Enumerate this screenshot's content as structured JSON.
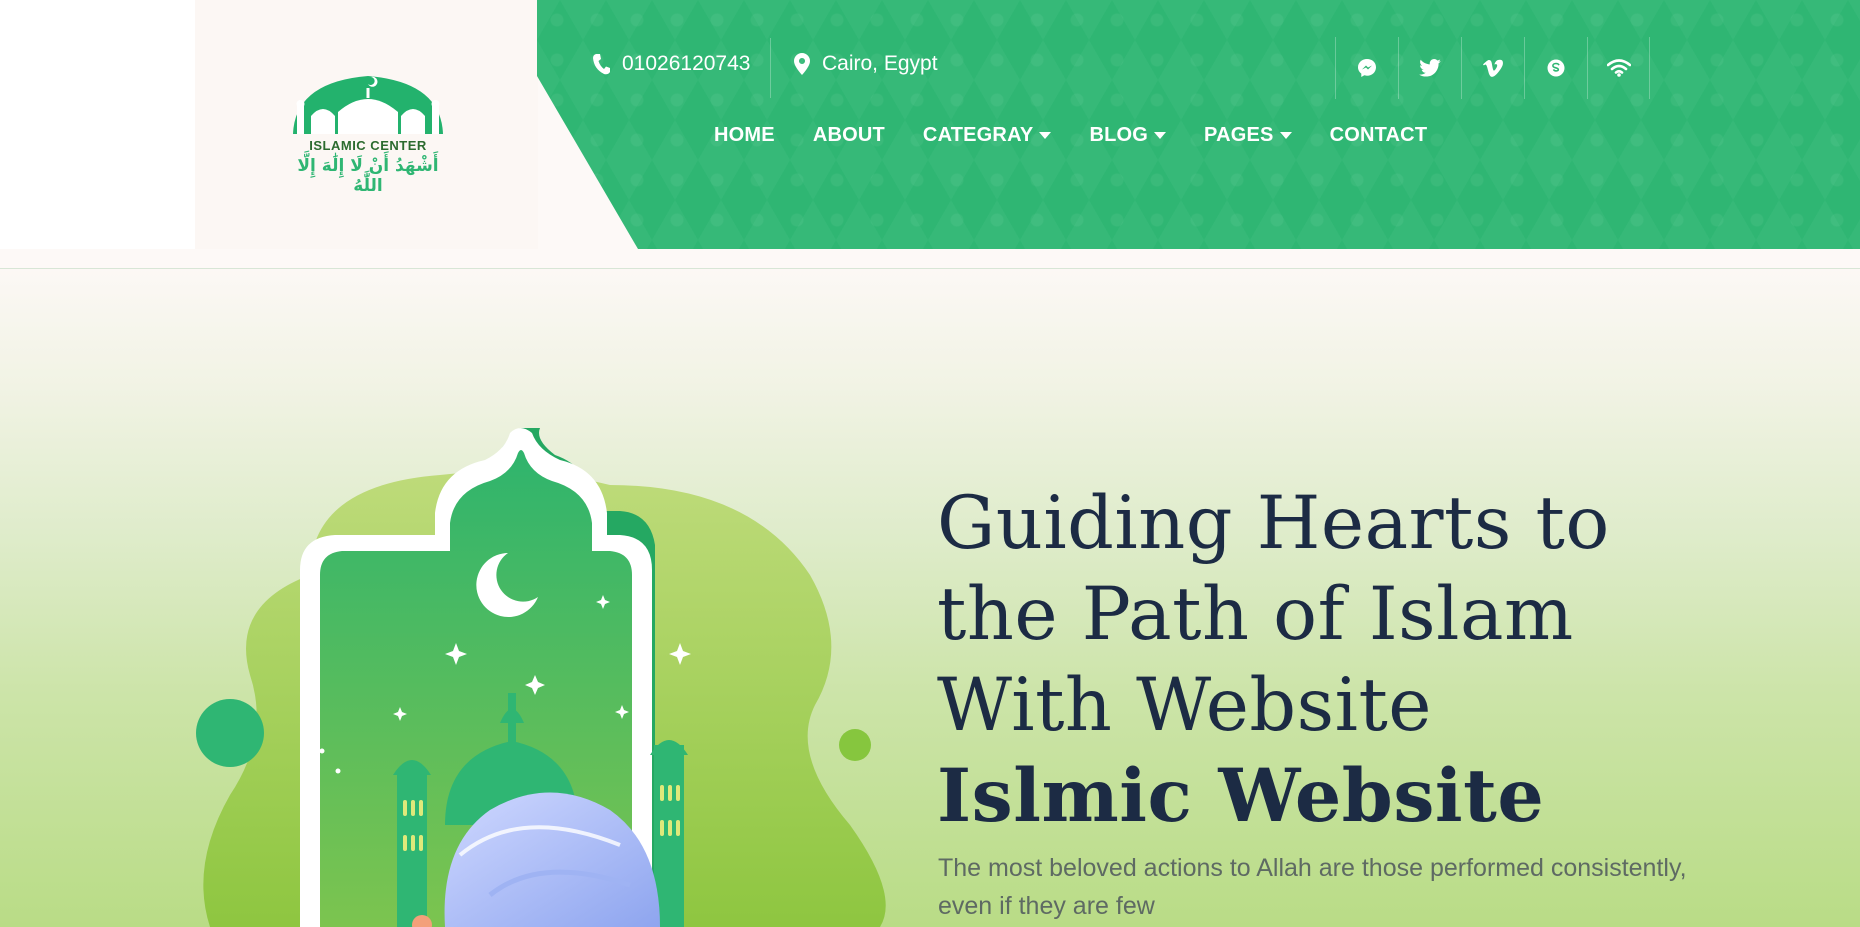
{
  "header": {
    "phone": "01026120743",
    "location": "Cairo, Egypt",
    "logo": {
      "title": "ISLAMIC CENTER",
      "arabic": "أَشْهَدُ أَنْ لَا إِلَٰهَ إِلَّا اللَّٰهُ"
    },
    "social_icons": [
      "messenger-icon",
      "twitter-icon",
      "vimeo-icon",
      "skype-icon",
      "wifi-icon"
    ],
    "nav": [
      {
        "label": "HOME",
        "dropdown": false
      },
      {
        "label": "ABOUT",
        "dropdown": false
      },
      {
        "label": "CATEGRAY",
        "dropdown": true
      },
      {
        "label": "BLOG",
        "dropdown": true
      },
      {
        "label": "PAGES",
        "dropdown": true
      },
      {
        "label": "CONTACT",
        "dropdown": false
      }
    ]
  },
  "hero": {
    "title_lines": [
      "Guiding Hearts to",
      "the Path of Islam",
      "With Website"
    ],
    "title_bold": "Islmic Website",
    "description": "The most beloved actions to Allah are those performed consistently, even if they are few"
  },
  "colors": {
    "brand_green": "#2fb673",
    "dark_text": "#1c2b44"
  }
}
